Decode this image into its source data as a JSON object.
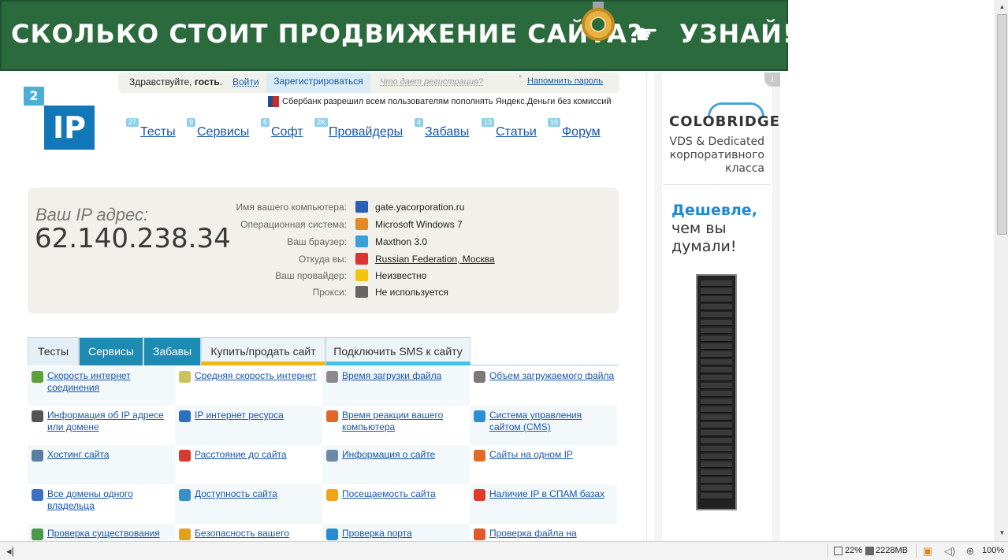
{
  "banner": {
    "text": "СКОЛЬКО СТОИТ ПРОДВИЖЕНИЕ САЙТА?",
    "cta": "УЗНАЙ!",
    "hand_icon": "pointing-hand-icon"
  },
  "login": {
    "greeting_prefix": "Здравствуйте, ",
    "greeting_name": "гость",
    "greeting_suffix": ".",
    "login_label": "Войти",
    "register_label": "Зарегистрироваться",
    "why_register": "Что дает регистрация?",
    "remind_password": "Напомнить пароль"
  },
  "news": {
    "text": "Сбербанк разрешил всем пользователям пополнять Яндекс.Деньги без комиссий"
  },
  "logo": {
    "small": "2",
    "big": "IP"
  },
  "nav": [
    {
      "badge": "27",
      "label": "Тесты"
    },
    {
      "badge": "9",
      "label": "Сервисы"
    },
    {
      "badge": "6",
      "label": "Софт"
    },
    {
      "badge": "2K",
      "label": "Провайдеры"
    },
    {
      "badge": "4",
      "label": "Забавы"
    },
    {
      "badge": "13",
      "label": "Статьи"
    },
    {
      "badge": "16",
      "label": "Форум"
    }
  ],
  "ip_info": {
    "title": "Ваш IP адрес:",
    "ip": "62.140.238.34",
    "rows": [
      {
        "label": "Имя вашего компьютера:",
        "value": "gate.yacorporation.ru",
        "icon": "computer-icon",
        "color": "#2b5fb3",
        "link": false
      },
      {
        "label": "Операционная система:",
        "value": "Microsoft Windows 7",
        "icon": "windows-icon",
        "color": "#e08a2a",
        "link": false
      },
      {
        "label": "Ваш браузер:",
        "value": "Maxthon 3.0",
        "icon": "browser-icon",
        "color": "#3aa1d8",
        "link": false
      },
      {
        "label": "Откуда вы:",
        "value": "Russian Federation, Москва",
        "icon": "russia-flag-icon",
        "color": "#d33",
        "link": true
      },
      {
        "label": "Ваш провайдер:",
        "value": "Неизвестно",
        "icon": "warning-icon",
        "color": "#f1c40f",
        "link": false
      },
      {
        "label": "Прокси:",
        "value": "Не используется",
        "icon": "glasses-icon",
        "color": "#666",
        "link": false
      }
    ]
  },
  "tabs": [
    {
      "label": "Тесты"
    },
    {
      "label": "Сервисы"
    },
    {
      "label": "Забавы"
    },
    {
      "label": "Купить/продать сайт"
    },
    {
      "label": "Подключить SMS к сайту"
    }
  ],
  "services": [
    {
      "label": "Скорость интернет соединения",
      "icon": "speed-arrow-icon",
      "color": "#5aa13b"
    },
    {
      "label": "Средняя скорость интернет",
      "icon": "bars-icon",
      "color": "#c9c35a"
    },
    {
      "label": "Время загрузки файла",
      "icon": "clock-icon",
      "color": "#8a8a8a"
    },
    {
      "label": "Объем загружаемого файла",
      "icon": "file-size-icon",
      "color": "#7a7a7a"
    },
    {
      "label": "Информация об IP адресе или домене",
      "icon": "ip-icon",
      "color": "#555"
    },
    {
      "label": "IP интернет ресурса",
      "icon": "ip-globe-icon",
      "color": "#2e6fbe"
    },
    {
      "label": "Время реакции вашего компьютера",
      "icon": "refresh-icon",
      "color": "#e0662a"
    },
    {
      "label": "Система управления сайтом (CMS)",
      "icon": "cms-gear-icon",
      "color": "#2f8fd6"
    },
    {
      "label": "Хостинг сайта",
      "icon": "hosting-icon",
      "color": "#5a7fa3"
    },
    {
      "label": "Расстояние до сайта",
      "icon": "map-pin-icon",
      "color": "#d63b2f"
    },
    {
      "label": "Информация о сайте",
      "icon": "document-icon",
      "color": "#6a8aa8"
    },
    {
      "label": "Сайты на одном IP",
      "icon": "network-icon",
      "color": "#e06a2a"
    },
    {
      "label": "Все домены одного владельца",
      "icon": "owner-globe-icon",
      "color": "#3d6fc2"
    },
    {
      "label": "Доступность сайта",
      "icon": "monitor-globe-icon",
      "color": "#3a8fc8"
    },
    {
      "label": "Посещаемость сайта",
      "icon": "star-icon",
      "color": "#f0a51c"
    },
    {
      "label": "Наличие IP в СПАМ базах",
      "icon": "no-spam-icon",
      "color": "#e03a2a"
    },
    {
      "label": "Проверка существования",
      "icon": "check-mail-icon",
      "color": "#4a9a4a"
    },
    {
      "label": "Безопасность вашего",
      "icon": "lock-icon",
      "color": "#e0a020"
    },
    {
      "label": "Проверка порта",
      "icon": "port-globe-icon",
      "color": "#2a8ad0"
    },
    {
      "label": "Проверка файла на",
      "icon": "virus-icon",
      "color": "#e05a2a"
    }
  ],
  "ad": {
    "brand": "COLOBRIDGE",
    "tag": "VDS & Dedicated корпоративного класса",
    "cheap_bold": "Дешевле,",
    "cheap_rest": "чем вы думали!",
    "info_icon": "info-icon"
  },
  "statusbar": {
    "cpu": "22%",
    "memory": "2228MB",
    "zoom": "100%"
  }
}
